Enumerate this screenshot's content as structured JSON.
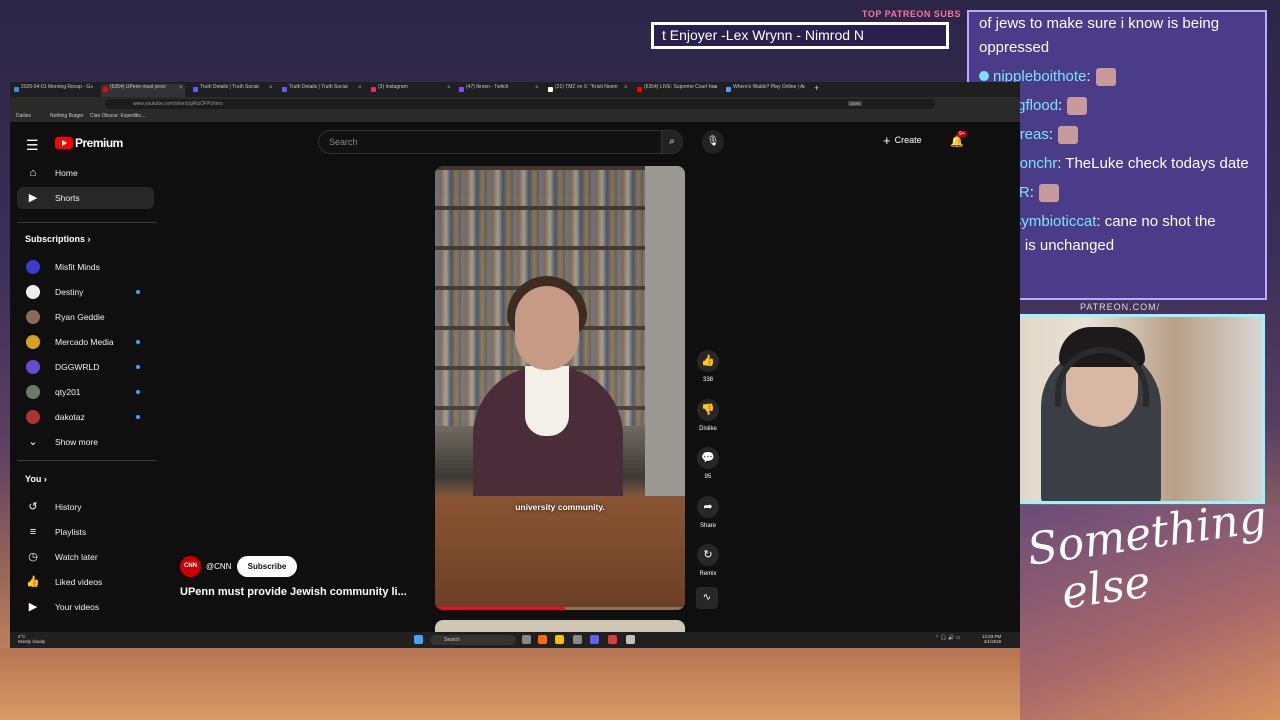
{
  "overlay": {
    "patreon_label": "TOP PATREON SUBS",
    "patreon_ticker": "t Enjoyer -Lex Wrynn - Nimrod N",
    "patreon_link": "PATREON.COM/",
    "stream_brand": "Something else"
  },
  "chat": {
    "partial_top": "of jews to make sure i know is being oppressed",
    "messages": [
      {
        "user": "nippleboithote",
        "text": ""
      },
      {
        "user": "Drugflood",
        "text": ""
      },
      {
        "user": "Andreas",
        "text": ""
      },
      {
        "user": "Hakonchr",
        "text": "TheLuke check todays date"
      },
      {
        "user": "FooR",
        "text": ""
      },
      {
        "user": "thesymbioticcat",
        "text": "cane no shot the emote is unchanged"
      }
    ]
  },
  "browser": {
    "tabs": [
      {
        "label": "2026-04-01 Morning Recap - G",
        "color": "#4285f4"
      },
      {
        "label": "(6354) UPenn must provi",
        "color": "#ff0000",
        "active": true
      },
      {
        "label": "Truth Details | Truth Social",
        "color": "#5b5bff"
      },
      {
        "label": "Truth Details | Truth Social",
        "color": "#5b5bff"
      },
      {
        "label": "(3) Instagram",
        "color": "#e1306c"
      },
      {
        "label": "(47) Ikrsen - Twitch",
        "color": "#9146ff"
      },
      {
        "label": "(21) TMZ on X: \"Kristi Noem",
        "color": "#ffffff"
      },
      {
        "label": "(6354) LIVE: Supreme Court hea",
        "color": "#ff0000"
      },
      {
        "label": "Where's Waldo? Play Online | A",
        "color": "#3ea6ff"
      }
    ],
    "url": "www.youtube.com/shorts/gRtzOFPzhmo",
    "zoom": "100%",
    "bookmarks": [
      "Dailies",
      "Nothing Burger",
      "Clair Obscur: Expeditio..."
    ]
  },
  "youtube": {
    "logo_text": "Premium",
    "search_placeholder": "Search",
    "create_label": "Create",
    "notifications_badge": "9+",
    "nav": [
      {
        "label": "Home",
        "icon": "home-icon",
        "glyph": "⌂"
      },
      {
        "label": "Shorts",
        "icon": "shorts-icon",
        "glyph": "▶",
        "active": true
      }
    ],
    "subscriptions_title": "Subscriptions",
    "subscriptions": [
      {
        "label": "Misfit Minds",
        "color": "#3a3acc",
        "new": false
      },
      {
        "label": "Destiny",
        "color": "#eeeeee",
        "new": true
      },
      {
        "label": "Ryan Geddie",
        "color": "#8a6a5a",
        "new": false
      },
      {
        "label": "Mercado Media",
        "color": "#d9a020",
        "new": true
      },
      {
        "label": "DGGWRLD",
        "color": "#6a4acc",
        "new": true
      },
      {
        "label": "qty201",
        "color": "#6a7a6a",
        "new": true
      },
      {
        "label": "dakotaz",
        "color": "#aa3333",
        "new": true
      }
    ],
    "show_more": "Show more",
    "you_title": "You",
    "you_items": [
      {
        "label": "History",
        "icon": "history-icon",
        "glyph": "↺"
      },
      {
        "label": "Playlists",
        "icon": "playlists-icon",
        "glyph": "≡"
      },
      {
        "label": "Watch later",
        "icon": "watch-later-icon",
        "glyph": "◷"
      },
      {
        "label": "Liked videos",
        "icon": "liked-videos-icon",
        "glyph": "👍"
      },
      {
        "label": "Your videos",
        "icon": "your-videos-icon",
        "glyph": "▶"
      }
    ],
    "short": {
      "caption": "university community.",
      "progress_fraction": 0.52,
      "channel_logo": "CNN",
      "channel_handle": "@CNN",
      "subscribe_label": "Subscribe",
      "title": "UPenn must provide Jewish community li..."
    },
    "actions": {
      "likes": "338",
      "dislike_label": "Dislike",
      "comments": "95",
      "share_label": "Share",
      "remix_label": "Remix"
    }
  },
  "taskbar": {
    "weather_temp": "4°C",
    "weather_desc": "Mostly cloudy",
    "search_label": "Search",
    "time": "12:03 PM",
    "date": "4/1/2026"
  }
}
